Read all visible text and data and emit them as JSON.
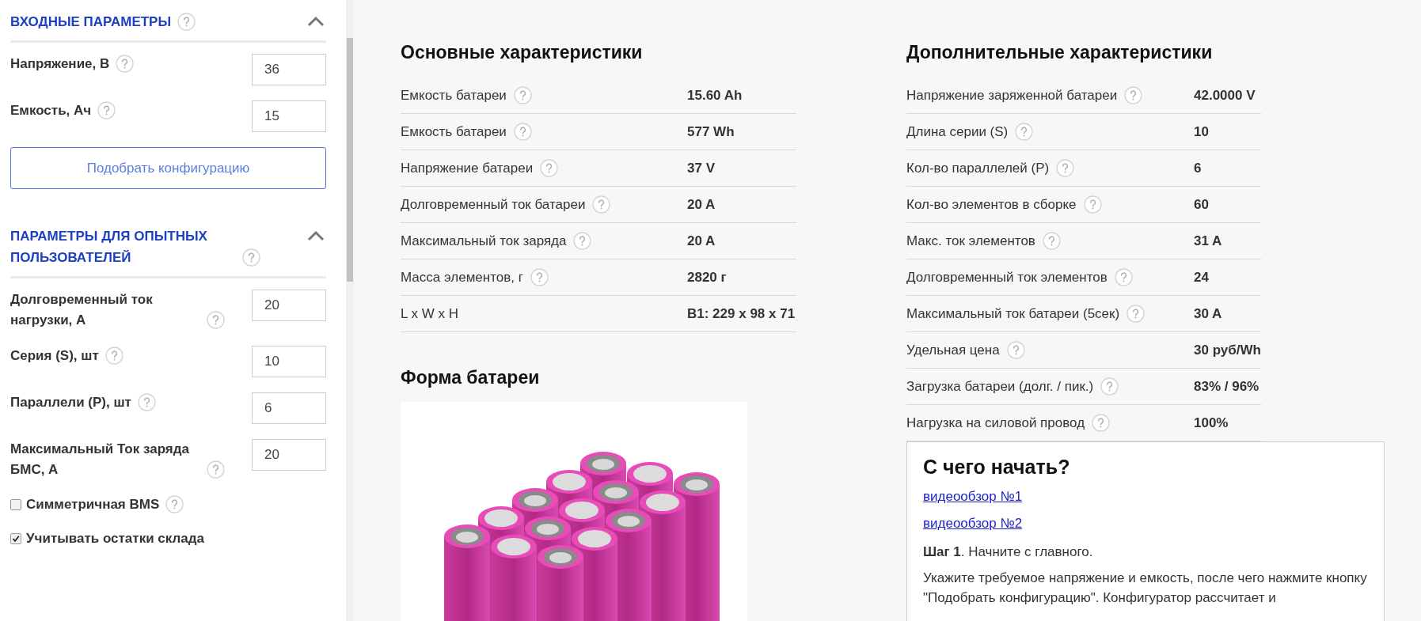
{
  "sidebar": {
    "sections": [
      {
        "title": "ВХОДНЫЕ ПАРАМЕТРЫ",
        "help": true,
        "expanded": true,
        "items": [
          {
            "kind": "input",
            "label": "Напряжение, В",
            "help": true,
            "value": "36"
          },
          {
            "kind": "input",
            "label": "Емкость, Ач",
            "help": true,
            "value": "15"
          },
          {
            "kind": "button",
            "label": "Подобрать конфигурацию"
          }
        ]
      },
      {
        "title": "ПАРАМЕТРЫ ДЛЯ ОПЫТНЫХ ПОЛЬЗОВАТЕЛЕЙ",
        "help": true,
        "expanded": true,
        "items": [
          {
            "kind": "input",
            "label": "Долговременный ток нагрузки, А",
            "help": true,
            "value": "20"
          },
          {
            "kind": "input",
            "label": "Серия (S), шт",
            "help": true,
            "value": "10"
          },
          {
            "kind": "input",
            "label": "Параллели (P), шт",
            "help": true,
            "value": "6"
          },
          {
            "kind": "input",
            "label": "Максимальный Ток заряда БМС, А",
            "help": true,
            "value": "20"
          },
          {
            "kind": "checkbox",
            "label": "Симметричная BMS",
            "help": true,
            "checked": false
          },
          {
            "kind": "checkbox",
            "label": "Учитывать остатки склада",
            "help": false,
            "checked": true
          }
        ]
      }
    ]
  },
  "main_specs": {
    "title": "Основные характеристики",
    "rows": [
      {
        "label": "Емкость батареи",
        "help": true,
        "value": "15.60 Ah"
      },
      {
        "label": "Емкость батареи",
        "help": true,
        "value": "577 Wh"
      },
      {
        "label": "Напряжение батареи",
        "help": true,
        "value": "37 V"
      },
      {
        "label": "Долговременный ток батареи",
        "help": true,
        "value": "20 A"
      },
      {
        "label": "Максимальный ток заряда",
        "help": true,
        "value": "20 A"
      },
      {
        "label": "Масса элементов, г",
        "help": true,
        "value": "2820 г"
      },
      {
        "label": "L x W x H",
        "help": false,
        "value": "B1: 229 x 98 x 71"
      }
    ]
  },
  "battery_shape": {
    "title": "Форма батареи"
  },
  "extra_specs": {
    "title": "Дополнительные характеристики",
    "rows": [
      {
        "label": "Напряжение заряженной батареи",
        "help": true,
        "value": "42.0000 V"
      },
      {
        "label": "Длина серии (S)",
        "help": true,
        "value": "10"
      },
      {
        "label": "Кол-во параллелей (P)",
        "help": true,
        "value": "6"
      },
      {
        "label": "Кол-во элементов в сборке",
        "help": true,
        "value": "60"
      },
      {
        "label": "Макс. ток элементов",
        "help": true,
        "value": "31 A"
      },
      {
        "label": "Долговременный ток элементов",
        "help": true,
        "value": "24"
      },
      {
        "label": "Максимальный ток батареи (5сек)",
        "help": true,
        "value": "30 A"
      },
      {
        "label": "Удельная цена",
        "help": true,
        "value": "30 руб/Wh"
      },
      {
        "label": "Загрузка батареи (долг. / пик.)",
        "help": true,
        "value": "83% / 96%"
      },
      {
        "label": "Нагрузка на силовой провод",
        "help": true,
        "value": "100%"
      }
    ]
  },
  "start_card": {
    "title": "С чего начать?",
    "links": [
      "видеообзор №1",
      "видеообзор №2"
    ],
    "paragraphs": [
      "**Шаг 1**. Начните с главного.",
      "Укажите требуемое напряжение и емкость, после чего нажмите кнопку \"Подобрать конфигурацию\". Конфигуратор рассчитает и"
    ]
  }
}
